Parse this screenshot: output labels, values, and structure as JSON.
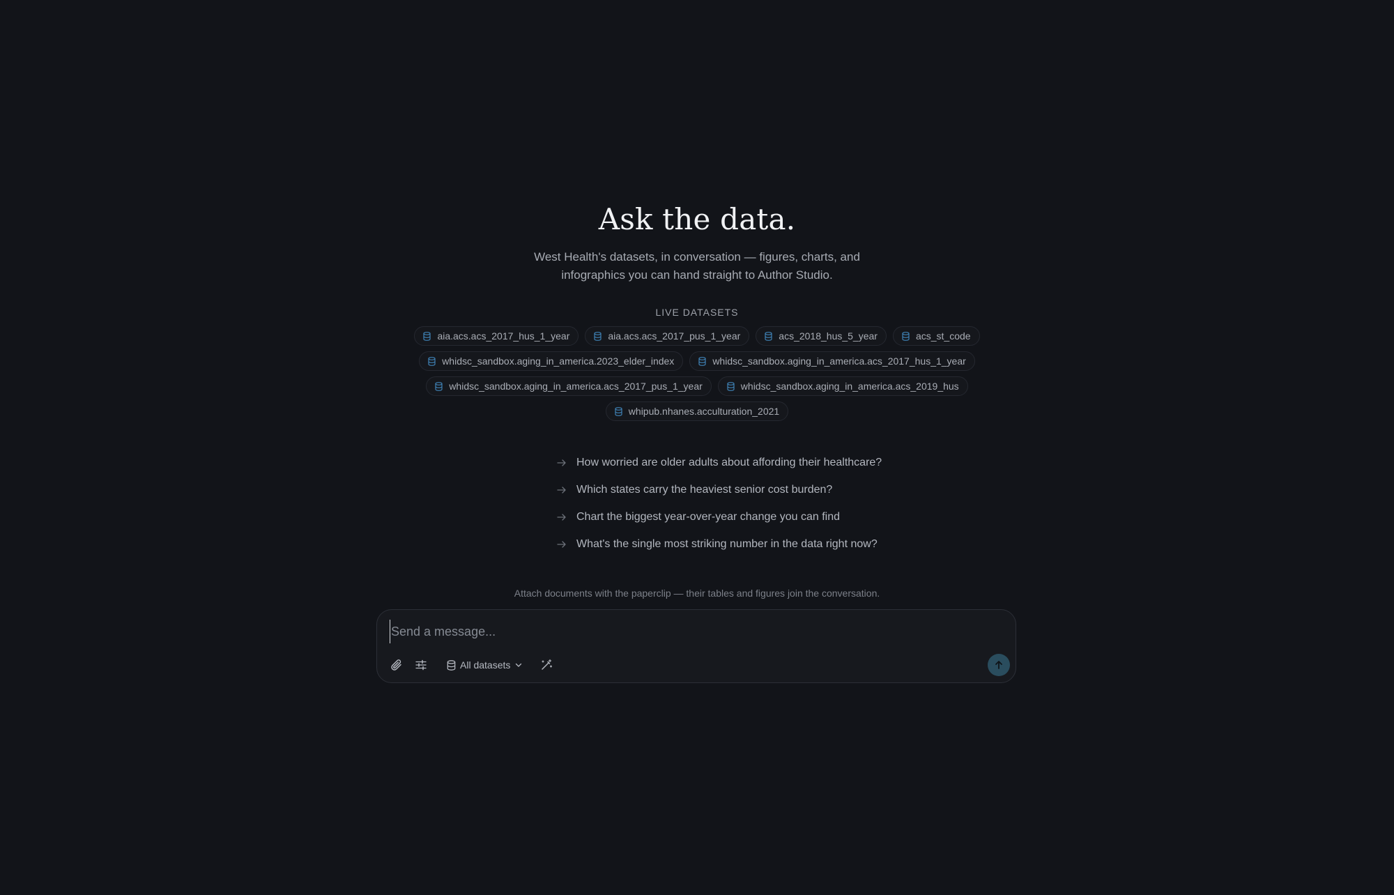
{
  "hero": {
    "title": "Ask the data.",
    "subtitle": "West Health's datasets, in conversation — figures, charts, and infographics you can hand straight to Author Studio."
  },
  "datasets": {
    "label": "LIVE DATASETS",
    "items": [
      "aia.acs.acs_2017_hus_1_year",
      "aia.acs.acs_2017_pus_1_year",
      "acs_2018_hus_5_year",
      "acs_st_code",
      "whidsc_sandbox.aging_in_america.2023_elder_index",
      "whidsc_sandbox.aging_in_america.acs_2017_hus_1_year",
      "whidsc_sandbox.aging_in_america.acs_2017_pus_1_year",
      "whidsc_sandbox.aging_in_america.acs_2019_hus",
      "whipub.nhanes.acculturation_2021"
    ]
  },
  "suggestions": [
    "How worried are older adults about affording their healthcare?",
    "Which states carry the heaviest senior cost burden?",
    "Chart the biggest year-over-year change you can find",
    "What's the single most striking number in the data right now?"
  ],
  "attach_note": "Attach documents with the paperclip — their tables and figures join the conversation.",
  "composer": {
    "placeholder": "Send a message...",
    "value": "",
    "dataset_select": "All datasets"
  },
  "icons": {
    "dataset": "database-icon",
    "suggestion": "arrow-right-icon",
    "attach": "paperclip-icon",
    "settings": "sliders-icon",
    "select": "database-icon",
    "dropdown": "chevron-down-icon",
    "enhance": "magic-wand-icon",
    "send": "arrow-up-icon"
  },
  "colors": {
    "background": "#121419",
    "accent_icon": "#3f82b6",
    "send_button": "#2a4d5e"
  }
}
